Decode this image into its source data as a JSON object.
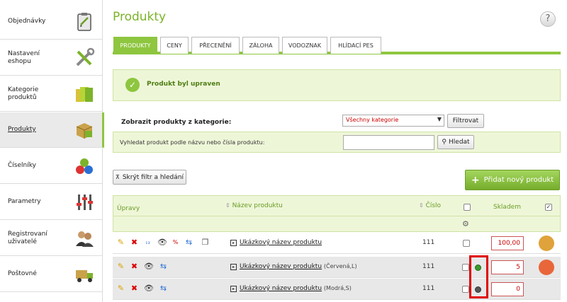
{
  "sidebar": {
    "items": [
      {
        "label": "Objednávky",
        "icon": "clipboard-icon"
      },
      {
        "label": "Nastavení eshopu",
        "icon": "tools-icon"
      },
      {
        "label": "Kategorie produktů",
        "icon": "folders-icon"
      },
      {
        "label": "Produkty",
        "icon": "box-icon"
      },
      {
        "label": "Číselníky",
        "icon": "numbers-icon"
      },
      {
        "label": "Parametry",
        "icon": "sliders-icon"
      },
      {
        "label": "Registrovaní uživatelé",
        "icon": "users-icon"
      },
      {
        "label": "Poštovné",
        "icon": "truck-icon"
      }
    ]
  },
  "header": {
    "title": "Produkty",
    "help": "?"
  },
  "tabs": [
    "PRODUKTY",
    "CENY",
    "PŘECENĚNÍ",
    "ZÁLOHA",
    "VODOZNAK",
    "HLÍDACÍ PES"
  ],
  "notice": {
    "message": "Produkt byl upraven"
  },
  "filter": {
    "category_label": "Zobrazit produkty z kategorie:",
    "category_value": "Všechny kategorie",
    "filter_button": "Filtrovat",
    "search_label": "Vyhledat produkt podle názvu nebo čísla produktu:",
    "search_value": "",
    "search_button": "Hledat"
  },
  "toolbar": {
    "toggle_label": "Skrýt filtr a hledání",
    "add_label": "Přidat nový produkt"
  },
  "table": {
    "headers": {
      "actions": "Úpravy",
      "name": "Název produktu",
      "number": "Číslo",
      "stock": "Skladem"
    },
    "rows": [
      {
        "name": "Ukázkový název produktu",
        "variant": "",
        "number": "111",
        "stock": "100,00"
      },
      {
        "name": "Ukázkový název produktu",
        "variant": "(Červená,L)",
        "number": "111",
        "stock": "5"
      },
      {
        "name": "Ukázkový název produktu",
        "variant": "(Modrá,S)",
        "number": "111",
        "stock": "0"
      }
    ]
  },
  "colors": {
    "accent": "#8ec63f",
    "highlight": "#e00000"
  }
}
